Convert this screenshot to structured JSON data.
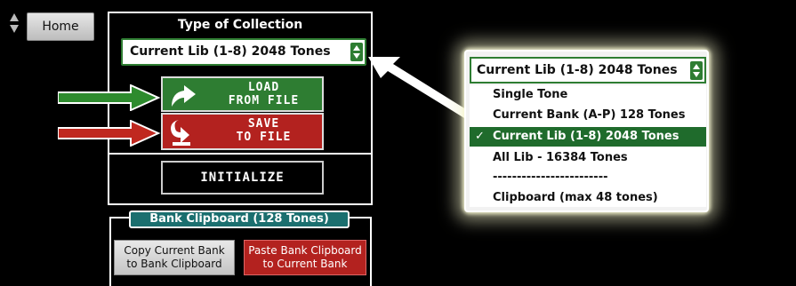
{
  "home": {
    "label": "Home",
    "sort_icon": "up-down-arrows-icon"
  },
  "collection": {
    "title": "Type of Collection",
    "selected": "Current Lib (1-8) 2048 Tones"
  },
  "buttons": {
    "load_line1": "LOAD",
    "load_line2": "FROM FILE",
    "save_line1": "SAVE",
    "save_line2": "TO FILE",
    "initialize": "INITIALIZE"
  },
  "clipboard": {
    "title": "Bank Clipboard (128 Tones)",
    "copy_line1": "Copy Current Bank",
    "copy_line2": "to Bank Clipboard",
    "paste_line1": "Paste Bank Clipboard",
    "paste_line2": "to Current Bank"
  },
  "dropdown": {
    "selected": "Current Lib (1-8) 2048 Tones",
    "options": [
      "Single Tone",
      "Current Bank (A-P) 128 Tones",
      "Current Lib (1-8) 2048 Tones",
      "All Lib - 16384 Tones",
      "------------------------",
      "Clipboard (max 48 tones)"
    ],
    "checked_index": 2
  },
  "colors": {
    "green": "#2e7d32",
    "red": "#b3221f",
    "teal": "#1b6f6f",
    "highlight": "#1f6b2c"
  }
}
